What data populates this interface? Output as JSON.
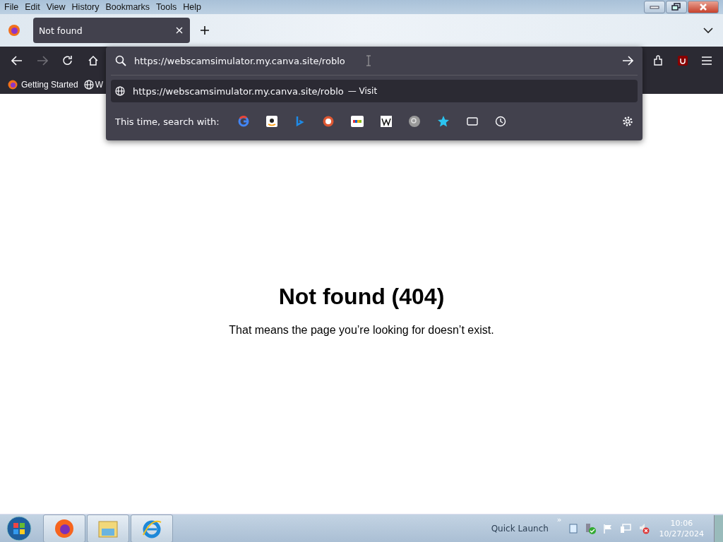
{
  "menu_bar": [
    "File",
    "Edit",
    "View",
    "History",
    "Bookmarks",
    "Tools",
    "Help"
  ],
  "tabs": [
    {
      "title": "Not found",
      "selected": true
    }
  ],
  "address_bar": {
    "value": "https://webscamsimulator.my.canva.site/roblo"
  },
  "suggestion": {
    "url": "https://webscamsimulator.my.canva.site/roblo",
    "action": "— Visit"
  },
  "search_with": {
    "label": "This time, search with:"
  },
  "bookmarks": [
    "Getting Started",
    "W"
  ],
  "page": {
    "heading": "Not found (404)",
    "message": "That means the page you’re looking for doesn’t exist."
  },
  "taskbar": {
    "quick_launch": "Quick Launch",
    "chevron": "»",
    "time": "10:06",
    "date": "10/27/2024"
  }
}
